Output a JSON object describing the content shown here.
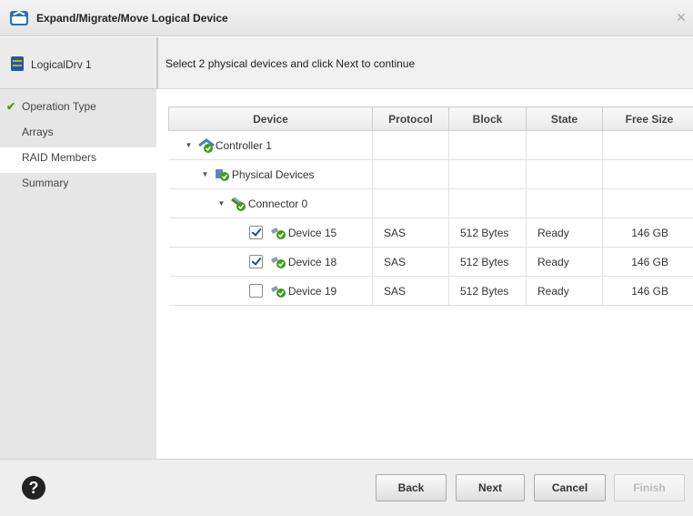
{
  "window": {
    "title": "Expand/Migrate/Move Logical Device",
    "close_icon": "close-icon"
  },
  "device": {
    "name": "LogicalDrv 1"
  },
  "instruction": "Select 2 physical devices and click Next to continue",
  "steps": [
    {
      "label": "Operation Type",
      "done": true
    },
    {
      "label": "Arrays",
      "done": false
    },
    {
      "label": "RAID Members",
      "active": true
    },
    {
      "label": "Summary",
      "done": false
    }
  ],
  "table": {
    "columns": [
      "Device",
      "Protocol",
      "Block",
      "State",
      "Free Size"
    ],
    "tree": [
      {
        "label": "Controller 1"
      },
      {
        "label": "Physical Devices"
      },
      {
        "label": "Connector 0"
      }
    ],
    "devices": [
      {
        "name": "Device 15",
        "checked": true,
        "protocol": "SAS",
        "block": "512 Bytes",
        "state": "Ready",
        "free_size": "146 GB"
      },
      {
        "name": "Device 18",
        "checked": true,
        "protocol": "SAS",
        "block": "512 Bytes",
        "state": "Ready",
        "free_size": "146 GB"
      },
      {
        "name": "Device 19",
        "checked": false,
        "protocol": "SAS",
        "block": "512 Bytes",
        "state": "Ready",
        "free_size": "146 GB"
      }
    ]
  },
  "buttons": {
    "back": "Back",
    "next": "Next",
    "cancel": "Cancel",
    "finish": "Finish"
  },
  "colors": {
    "accent_check": "#4a9a1a",
    "disabled_text": "#bbbbbb"
  }
}
